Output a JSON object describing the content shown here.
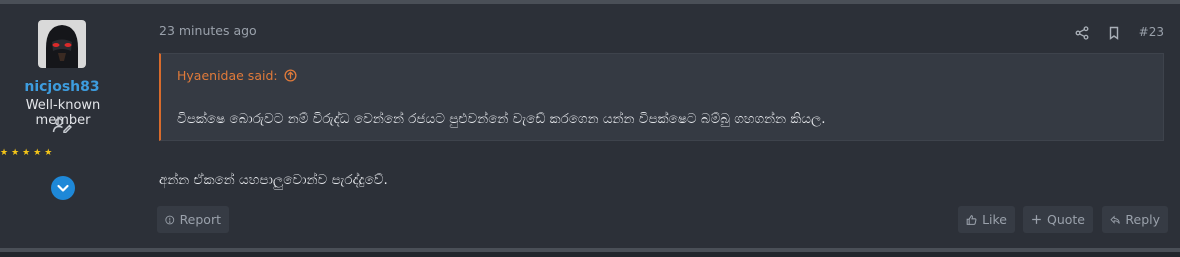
{
  "post": {
    "author": {
      "username": "nicjosh83",
      "title": "Well-known member",
      "rating_stars": "★★★★★"
    },
    "timestamp": "23 minutes ago",
    "post_number": "#23",
    "quote": {
      "author_label": "Hyaenidae said:",
      "text": "විපක්ෂෙ බොරුවට නම් විරුද්ධ වෙන්නේ රජයට පුළුවන්නේ වැඩේ කරගෙන යන්න විපක්ෂෙට බම්බු ගහගන්න කියල."
    },
    "body": "අන්න ඒකනේ යහපාලුවොන්ව පැරද්දුවේ.",
    "buttons": {
      "report": "Report",
      "like": "Like",
      "quote": "Quote",
      "reply": "Reply"
    }
  },
  "colors": {
    "background": "#2c3038",
    "username": "#3d9cde",
    "quote_accent": "#d86b2c",
    "quote_author": "#e07a3a",
    "stars": "#f5c518",
    "expand_button": "#1e88d8"
  },
  "icons": [
    "user-edit-icon",
    "chevron-down-icon",
    "share-icon",
    "bookmark-icon",
    "arrow-up-circle-icon",
    "report-icon",
    "like-icon",
    "plus-icon",
    "reply-icon"
  ]
}
